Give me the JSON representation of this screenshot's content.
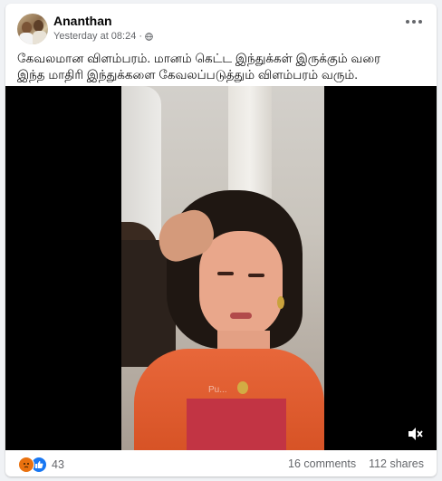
{
  "post": {
    "author": "Ananthan",
    "timestamp": "Yesterday at 08:24",
    "separator": "·",
    "text_line1": "கேவலமான விளம்பரம். மானம் கெட்ட இந்துக்கள் இருக்கும் வரை",
    "text_line2": "இந்த மாதிரி இந்துக்களை கேவலப்படுத்தும் விளம்பரம் வரும்."
  },
  "video": {
    "watermark": "Pu...",
    "muted": true
  },
  "footer": {
    "reaction_count": "43",
    "comments": "16 comments",
    "shares": "112 shares",
    "reactions": [
      "angry-icon",
      "like-icon"
    ]
  },
  "colors": {
    "angry": "#e9710f",
    "like": "#1877f2",
    "secondary_text": "#65676b"
  }
}
